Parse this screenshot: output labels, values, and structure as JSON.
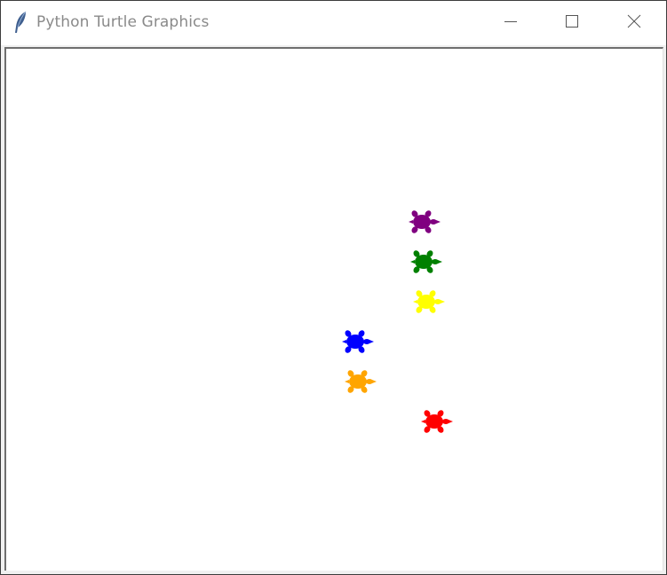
{
  "window": {
    "title": "Python Turtle Graphics",
    "icon": "feather-icon"
  },
  "controls": {
    "minimize": "minimize-icon",
    "maximize": "maximize-icon",
    "close": "close-icon"
  },
  "turtles": [
    {
      "name": "purple",
      "color": "#800080"
    },
    {
      "name": "green",
      "color": "#008000"
    },
    {
      "name": "yellow",
      "color": "#ffff00"
    },
    {
      "name": "blue",
      "color": "#0000ff"
    },
    {
      "name": "orange",
      "color": "#ffa500"
    },
    {
      "name": "red",
      "color": "#ff0000"
    }
  ]
}
